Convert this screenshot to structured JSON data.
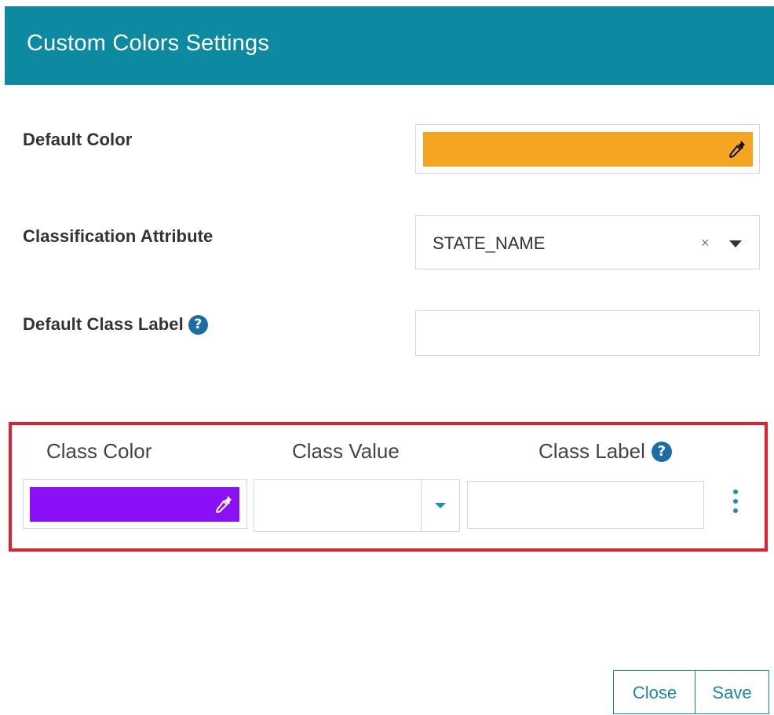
{
  "header": {
    "title": "Custom Colors Settings"
  },
  "default_color": {
    "label": "Default Color",
    "color": "#f4a623",
    "icon": "eyedropper-icon"
  },
  "classification_attribute": {
    "label": "Classification Attribute",
    "value": "STATE_NAME",
    "clear_glyph": "×"
  },
  "default_class_label": {
    "label": "Default Class Label",
    "help_glyph": "?",
    "value": ""
  },
  "class_table": {
    "headers": {
      "color": "Class Color",
      "value": "Class Value",
      "label": "Class Label",
      "help_glyph": "?"
    },
    "rows": [
      {
        "color": "#8b10f5",
        "value": "",
        "label": ""
      }
    ],
    "highlight_color": "#e0202e"
  },
  "footer": {
    "close_label": "Close",
    "save_label": "Save"
  },
  "colors": {
    "header_bg": "#0d89a1",
    "accent": "#1a86a2"
  }
}
